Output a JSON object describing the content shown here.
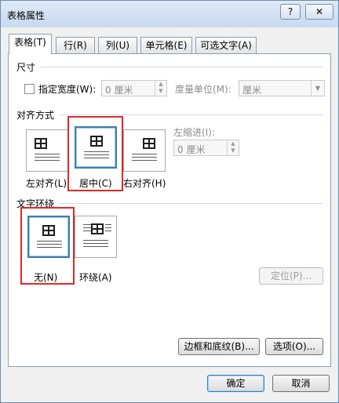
{
  "window": {
    "title": "表格属性",
    "help_label": "?",
    "close_label": "✕"
  },
  "tabs": [
    {
      "label": "表格(T)"
    },
    {
      "label": "行(R)"
    },
    {
      "label": "列(U)"
    },
    {
      "label": "单元格(E)"
    },
    {
      "label": "可选文字(A)"
    }
  ],
  "size": {
    "section_label": "尺寸",
    "specify_width_label": "指定宽度(W):",
    "width_value": "0 厘米",
    "unit_label": "度量单位(M):",
    "unit_value": "厘米"
  },
  "alignment": {
    "section_label": "对齐方式",
    "options": [
      "左对齐(L)",
      "居中(C)",
      "右对齐(H)"
    ],
    "selected": "居中(C)",
    "indent_label": "左缩进(I):",
    "indent_value": "0 厘米"
  },
  "wrapping": {
    "section_label": "文字环绕",
    "options": [
      "无(N)",
      "环绕(A)"
    ],
    "selected": "无(N)",
    "position_button": "定位(P)..."
  },
  "buttons": {
    "borders": "边框和底纹(B)...",
    "options": "选项(O)...",
    "ok": "确定",
    "cancel": "取消"
  },
  "colors": {
    "highlight_box": "#e0282a",
    "selection_border": "#3c7fb1"
  }
}
